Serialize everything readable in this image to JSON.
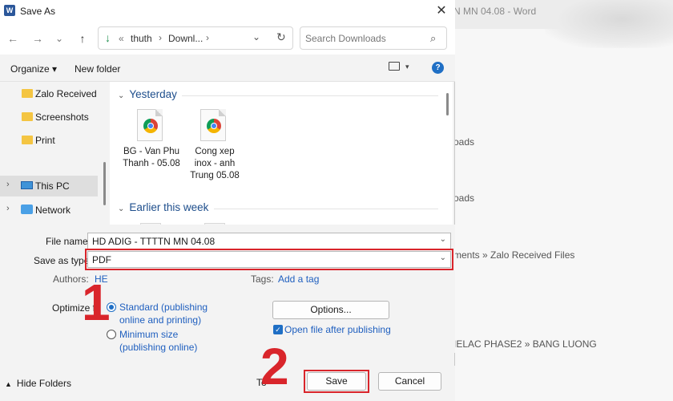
{
  "background": {
    "window_title": "N MN 04.08 - Word",
    "recent_items": [
      {
        "text": "oads"
      },
      {
        "text": "oads"
      },
      {
        "text": "ments » Zalo Received Files"
      },
      {
        "text": "IELAC PHASE2 » BANG LUONG"
      }
    ]
  },
  "dialog": {
    "title": "Save As",
    "app_icon_letter": "W",
    "close_glyph": "✕",
    "nav": {
      "back_glyph": "←",
      "forward_glyph": "→",
      "recent_glyph": "⌄",
      "up_glyph": "↑"
    },
    "address": {
      "overflow": "«",
      "crumbs": [
        "thuth",
        "Downl..."
      ],
      "sep_glyph": "›",
      "dropdown_glyph": "⌄",
      "refresh_glyph": "↻"
    },
    "search": {
      "placeholder": "Search Downloads",
      "icon_glyph": "⌕"
    },
    "toolbar": {
      "organize": "Organize ▾",
      "new_folder": "New folder",
      "view_dd_glyph": "▾",
      "help_glyph": "?"
    },
    "nav_pane": {
      "items": [
        {
          "label": "Zalo Received Fil",
          "icon": "folder-icon"
        },
        {
          "label": "Screenshots",
          "icon": "folder-icon"
        },
        {
          "label": "Print",
          "icon": "folder-icon"
        },
        {
          "label": "This PC",
          "icon": "computer-icon",
          "selected": true
        },
        {
          "label": "Network",
          "icon": "network-icon"
        }
      ],
      "expand_glyph": "›"
    },
    "files": {
      "group_chevron": "⌄",
      "groups": [
        {
          "name": "Yesterday",
          "items": [
            {
              "name": "BG - Van Phu Thanh - 05.08",
              "icon": "chrome-icon"
            },
            {
              "name": "Cong xep inox - anh Trung 05.08",
              "icon": "chrome-icon"
            }
          ]
        },
        {
          "name": "Earlier this week",
          "items": []
        }
      ]
    },
    "form": {
      "file_name_label": "File name:",
      "file_name_value": "HD ADIG - TTTTN MN 04.08",
      "save_type_label": "Save as type:",
      "save_type_value": "PDF",
      "combo_arrow": "⌄",
      "authors_label": "Authors:",
      "authors_value": "HE",
      "tags_label": "Tags:",
      "tags_value": "Add a tag",
      "optimize_label": "Optimize fo",
      "optimize_options": [
        {
          "text": "Standard (publishing online and printing)",
          "selected": true
        },
        {
          "text": "Minimum size (publishing online)",
          "selected": false
        }
      ],
      "options_button": "Options...",
      "open_after_label": "Open file after publishing",
      "open_after_checked": true,
      "check_glyph": "✓"
    },
    "bottom": {
      "hide_folders": "Hide Folders",
      "hide_glyph": "▲",
      "tools_partial": "To",
      "save_button": "Save",
      "cancel_button": "Cancel"
    }
  },
  "annotations": {
    "step_one": "1",
    "step_two": "2",
    "highlight_color": "#d9252b"
  }
}
